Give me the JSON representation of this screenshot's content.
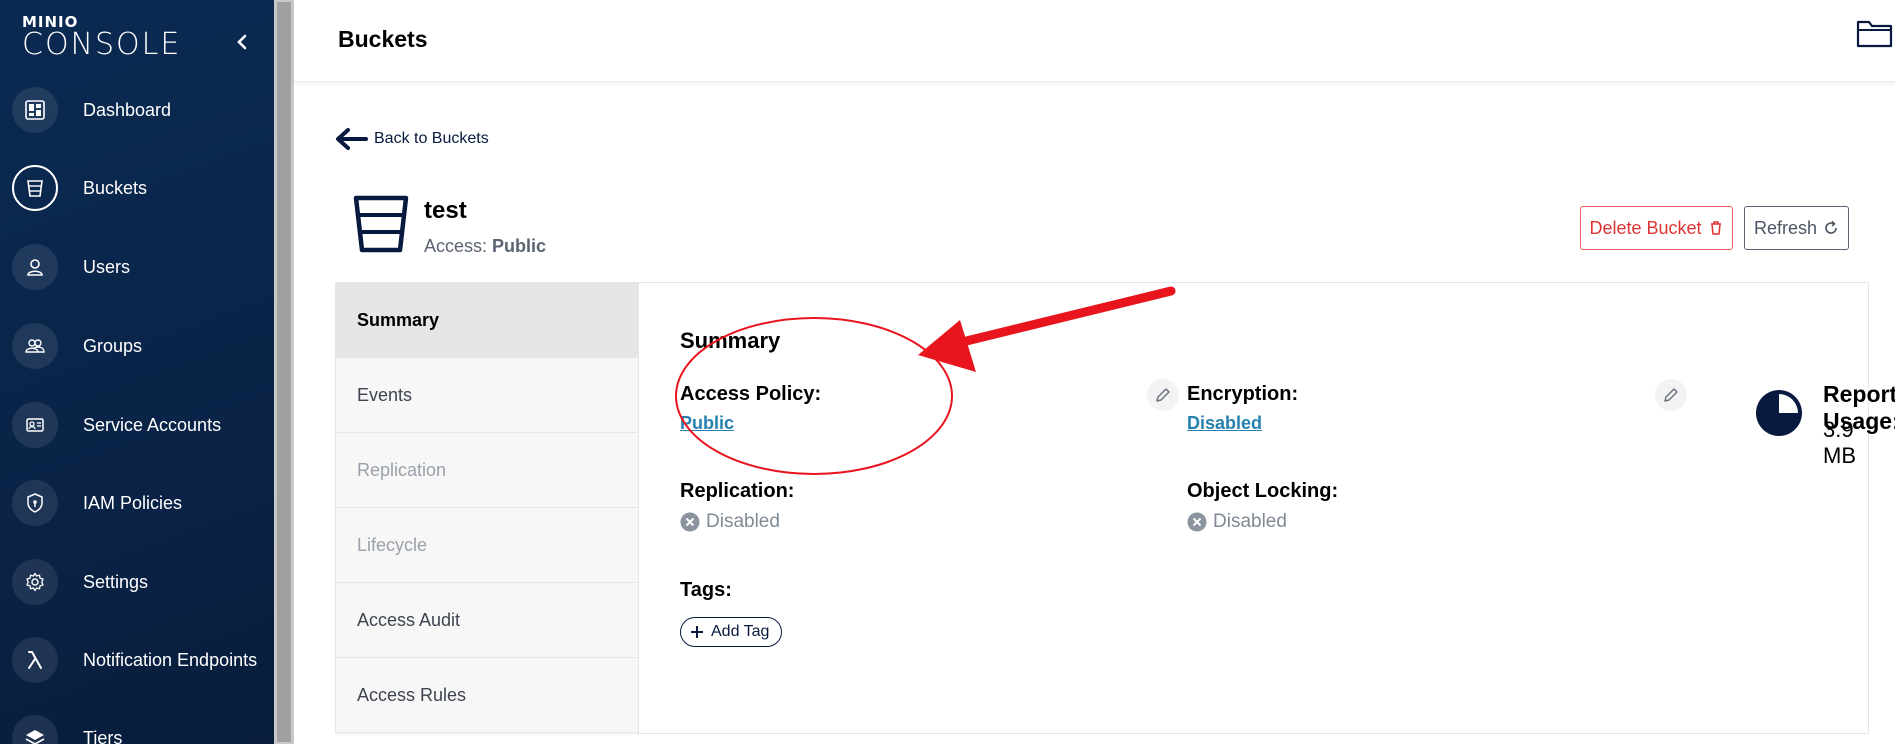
{
  "brand": {
    "small": "MINIO",
    "big": "CONSOLE"
  },
  "sidebar": {
    "items": [
      {
        "label": "Dashboard",
        "icon": "dashboard-icon"
      },
      {
        "label": "Buckets",
        "icon": "bucket-icon",
        "active": true
      },
      {
        "label": "Users",
        "icon": "user-icon"
      },
      {
        "label": "Groups",
        "icon": "groups-icon"
      },
      {
        "label": "Service Accounts",
        "icon": "service-accounts-icon"
      },
      {
        "label": "IAM Policies",
        "icon": "shield-icon"
      },
      {
        "label": "Settings",
        "icon": "gear-icon"
      },
      {
        "label": "Notification Endpoints",
        "icon": "lambda-icon"
      },
      {
        "label": "Tiers",
        "icon": "layers-icon"
      }
    ]
  },
  "header": {
    "title": "Buckets"
  },
  "main": {
    "back_label": "Back to Buckets",
    "bucket": {
      "name": "test",
      "access_prefix": "Access:",
      "access_value": "Public"
    },
    "actions": {
      "delete_label": "Delete Bucket",
      "refresh_label": "Refresh"
    },
    "tabs": [
      {
        "label": "Summary",
        "state": "active"
      },
      {
        "label": "Events",
        "state": "enabled"
      },
      {
        "label": "Replication",
        "state": "disabled"
      },
      {
        "label": "Lifecycle",
        "state": "disabled"
      },
      {
        "label": "Access Audit",
        "state": "enabled"
      },
      {
        "label": "Access Rules",
        "state": "enabled"
      }
    ],
    "summary": {
      "title": "Summary",
      "access_policy_label": "Access Policy:",
      "access_policy_value": "Public",
      "encryption_label": "Encryption:",
      "encryption_value": "Disabled",
      "replication_label": "Replication:",
      "replication_value": "Disabled",
      "object_locking_label": "Object Locking:",
      "object_locking_value": "Disabled",
      "tags_label": "Tags:",
      "add_tag_label": "Add Tag",
      "usage_label": "Reported Usage:",
      "usage_value": "3.9 MB"
    }
  },
  "colors": {
    "sidebar_bg": "#0b2a52",
    "delete": "#e03434",
    "link": "#2781b0",
    "annotation": "#e8141e"
  }
}
